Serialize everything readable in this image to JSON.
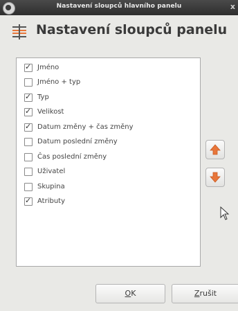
{
  "window": {
    "title": "Nastavení sloupců hlavního panelu",
    "close_glyph": "x"
  },
  "header": {
    "title": "Nastavení sloupců panelu",
    "icon": "columns-settings-icon"
  },
  "columns": [
    {
      "label": "Jméno",
      "checked": true
    },
    {
      "label": "Jméno + typ",
      "checked": false
    },
    {
      "label": "Typ",
      "checked": true
    },
    {
      "label": "Velikost",
      "checked": true
    },
    {
      "label": "Datum změny + čas změny",
      "checked": true
    },
    {
      "label": "Datum poslední změny",
      "checked": false
    },
    {
      "label": "Čas poslední změny",
      "checked": false
    },
    {
      "label": "Uživatel",
      "checked": false
    },
    {
      "label": "Skupina",
      "checked": false
    },
    {
      "label": "Atributy",
      "checked": true
    }
  ],
  "buttons": {
    "ok": {
      "mnemonic": "O",
      "rest": "K"
    },
    "cancel": {
      "mnemonic": "Z",
      "rest": "rušit"
    },
    "move_up_icon": "arrow-up-icon",
    "move_down_icon": "arrow-down-icon"
  },
  "colors": {
    "arrow": "#e8763a",
    "titlebar": "#3a3a3a"
  }
}
